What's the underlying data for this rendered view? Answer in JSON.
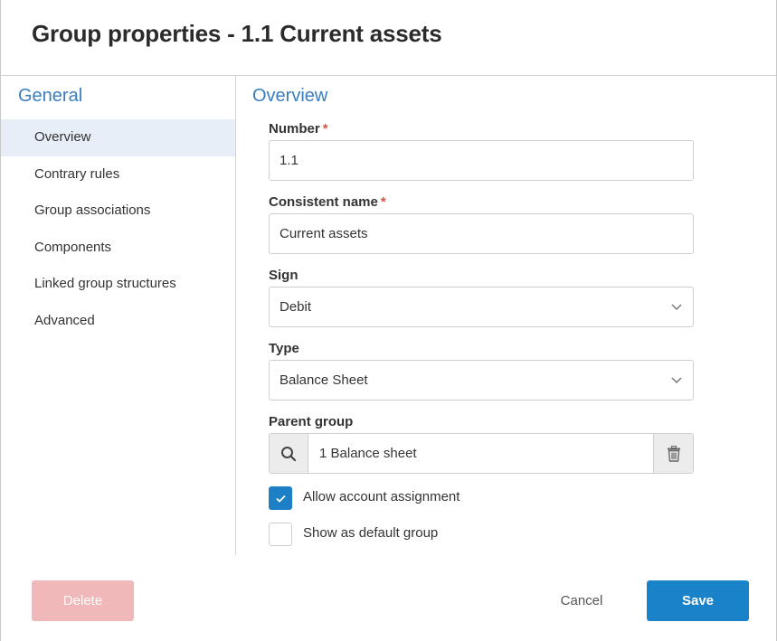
{
  "dialog": {
    "title": "Group properties - 1.1 Current assets"
  },
  "sidebar": {
    "heading": "General",
    "items": [
      {
        "label": "Overview",
        "active": true
      },
      {
        "label": "Contrary rules",
        "active": false
      },
      {
        "label": "Group associations",
        "active": false
      },
      {
        "label": "Components",
        "active": false
      },
      {
        "label": "Linked group structures",
        "active": false
      },
      {
        "label": "Advanced",
        "active": false
      }
    ]
  },
  "overview": {
    "heading": "Overview",
    "required_marker": "*",
    "number": {
      "label": "Number",
      "value": "1.1",
      "required": true
    },
    "consistent_name": {
      "label": "Consistent name",
      "value": "Current assets",
      "required": true
    },
    "sign": {
      "label": "Sign",
      "value": "Debit"
    },
    "type": {
      "label": "Type",
      "value": "Balance Sheet"
    },
    "parent_group": {
      "label": "Parent group",
      "value": "1 Balance sheet"
    },
    "allow_account_assignment": {
      "label": "Allow account assignment",
      "checked": true
    },
    "show_as_default_group": {
      "label": "Show as default group",
      "checked": false
    }
  },
  "footer": {
    "delete_label": "Delete",
    "cancel_label": "Cancel",
    "save_label": "Save"
  },
  "colors": {
    "accent": "#3a7dbf",
    "primary_button": "#1a82c8",
    "delete_button": "#f0b8b8",
    "required": "#d9534f",
    "active_nav": "#e8eef7"
  }
}
